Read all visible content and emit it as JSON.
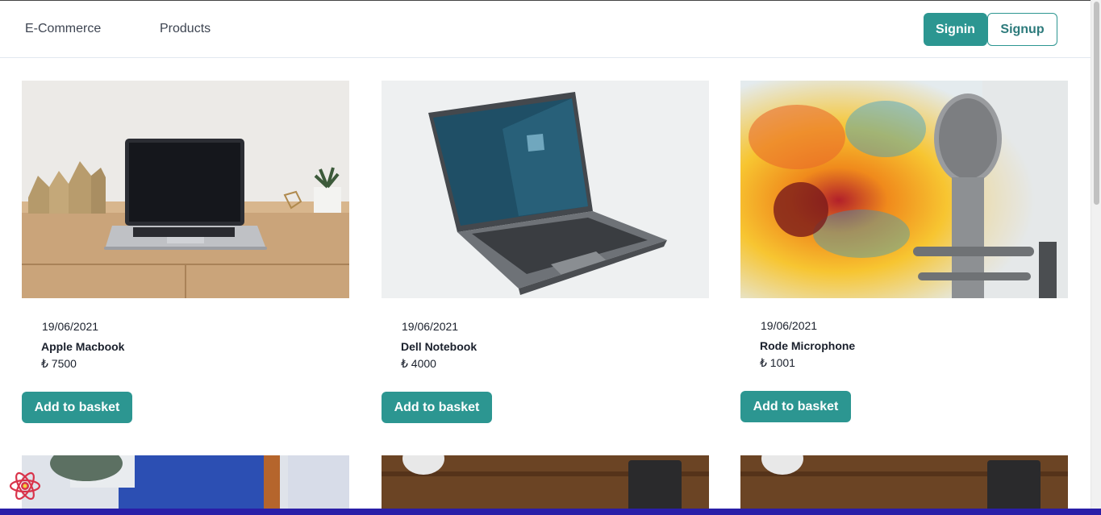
{
  "navbar": {
    "brand": "E-Commerce",
    "products_link": "Products",
    "signin_label": "Signin",
    "signup_label": "Signup"
  },
  "products": [
    {
      "date": "19/06/2021",
      "title": "Apple Macbook",
      "price": "₺ 7500",
      "button": "Add to basket"
    },
    {
      "date": "19/06/2021",
      "title": "Dell Notebook",
      "price": "₺ 4000",
      "button": "Add to basket"
    },
    {
      "date": "19/06/2021",
      "title": "Rode Microphone",
      "price": "₺ 1001",
      "button": "Add to basket"
    }
  ],
  "colors": {
    "accent": "#2c9691",
    "taskbar": "#2a1ea8"
  },
  "icons": {
    "devtools": "react-devtools-icon"
  }
}
